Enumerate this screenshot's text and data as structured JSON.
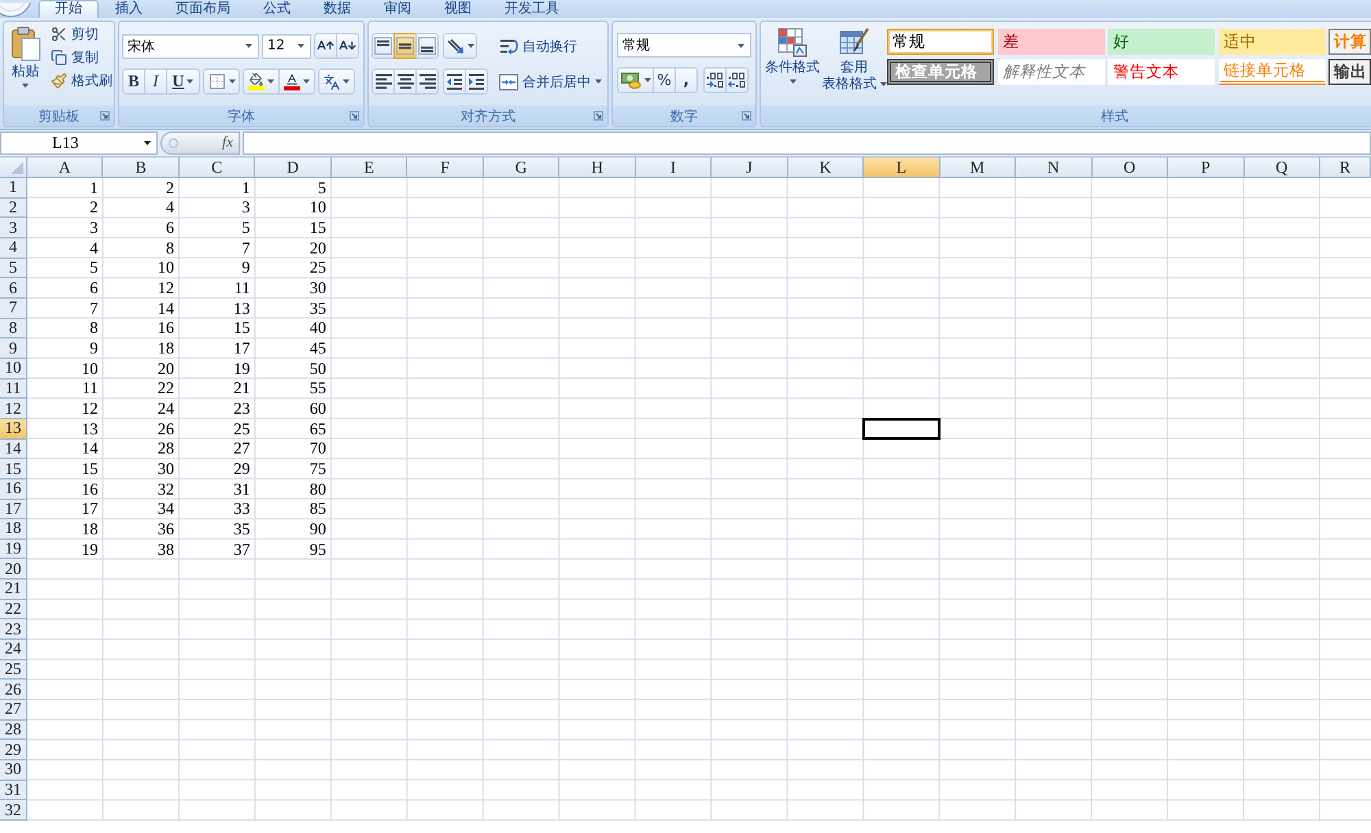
{
  "tabs": [
    {
      "label": "开始",
      "selected": true
    },
    {
      "label": "插入",
      "selected": false
    },
    {
      "label": "页面布局",
      "selected": false
    },
    {
      "label": "公式",
      "selected": false
    },
    {
      "label": "数据",
      "selected": false
    },
    {
      "label": "审阅",
      "selected": false
    },
    {
      "label": "视图",
      "selected": false
    },
    {
      "label": "开发工具",
      "selected": false
    }
  ],
  "clipboard": {
    "title": "剪贴板",
    "paste": "粘贴",
    "actions": [
      {
        "kind": "cut",
        "label": "剪切"
      },
      {
        "kind": "copy",
        "label": "复制"
      },
      {
        "kind": "format_painter",
        "label": "格式刷"
      }
    ]
  },
  "font": {
    "title": "字体",
    "font_name": "宋体",
    "font_size": "12",
    "styles": [
      {
        "kind": "bold",
        "label": "B"
      },
      {
        "kind": "italic",
        "label": "I"
      },
      {
        "kind": "underline",
        "label": "U"
      }
    ]
  },
  "alignment": {
    "title": "对齐方式",
    "vertical": [
      {
        "kind": "top",
        "selected": false
      },
      {
        "kind": "middle",
        "selected": true
      },
      {
        "kind": "bottom",
        "selected": false
      }
    ],
    "horizontal": [
      {
        "kind": "left",
        "selected": false
      },
      {
        "kind": "center",
        "selected": false
      },
      {
        "kind": "right",
        "selected": false
      }
    ],
    "wrap_text": "自动换行",
    "merge_center": "合并后居中"
  },
  "number": {
    "title": "数字",
    "format": "常规",
    "symbols": [
      {
        "kind": "percent",
        "label": "%"
      },
      {
        "kind": "comma",
        "label": ","
      }
    ]
  },
  "styles": {
    "title": "样式",
    "conditional_formatting": "条件格式",
    "format_as_table": [
      "套用",
      "表格格式"
    ],
    "cell_styles": [
      {
        "kind": "normal",
        "label": "常规",
        "selected": true
      },
      {
        "kind": "bad",
        "label": "差",
        "selected": false
      },
      {
        "kind": "good",
        "label": "好",
        "selected": false
      },
      {
        "kind": "neutral",
        "label": "适中",
        "selected": false
      },
      {
        "kind": "calculation",
        "label": "计算",
        "selected": false
      },
      {
        "kind": "check",
        "label": "检查单元格",
        "selected": false
      },
      {
        "kind": "explanatory",
        "label": "解释性文本",
        "selected": false
      },
      {
        "kind": "warning",
        "label": "警告文本",
        "selected": false
      },
      {
        "kind": "linked",
        "label": "链接单元格",
        "selected": false
      },
      {
        "kind": "output",
        "label": "输出",
        "selected": false
      }
    ]
  },
  "formula_bar": {
    "name_box": "L13",
    "function_label": "fx"
  },
  "grid": {
    "columns": [
      {
        "label": "A",
        "selected": false
      },
      {
        "label": "B",
        "selected": false
      },
      {
        "label": "C",
        "selected": false
      },
      {
        "label": "D",
        "selected": false
      },
      {
        "label": "E",
        "selected": false
      },
      {
        "label": "F",
        "selected": false
      },
      {
        "label": "G",
        "selected": false
      },
      {
        "label": "H",
        "selected": false
      },
      {
        "label": "I",
        "selected": false
      },
      {
        "label": "J",
        "selected": false
      },
      {
        "label": "K",
        "selected": false
      },
      {
        "label": "L",
        "selected": true
      },
      {
        "label": "M",
        "selected": false
      },
      {
        "label": "N",
        "selected": false
      },
      {
        "label": "O",
        "selected": false
      },
      {
        "label": "P",
        "selected": false
      },
      {
        "label": "Q",
        "selected": false
      },
      {
        "label": "R",
        "selected": false
      }
    ],
    "rows": [
      {
        "label": "1",
        "selected": false,
        "cells": [
          "1",
          "2",
          "1",
          "5"
        ]
      },
      {
        "label": "2",
        "selected": false,
        "cells": [
          "2",
          "4",
          "3",
          "10"
        ]
      },
      {
        "label": "3",
        "selected": false,
        "cells": [
          "3",
          "6",
          "5",
          "15"
        ]
      },
      {
        "label": "4",
        "selected": false,
        "cells": [
          "4",
          "8",
          "7",
          "20"
        ]
      },
      {
        "label": "5",
        "selected": false,
        "cells": [
          "5",
          "10",
          "9",
          "25"
        ]
      },
      {
        "label": "6",
        "selected": false,
        "cells": [
          "6",
          "12",
          "11",
          "30"
        ]
      },
      {
        "label": "7",
        "selected": false,
        "cells": [
          "7",
          "14",
          "13",
          "35"
        ]
      },
      {
        "label": "8",
        "selected": false,
        "cells": [
          "8",
          "16",
          "15",
          "40"
        ]
      },
      {
        "label": "9",
        "selected": false,
        "cells": [
          "9",
          "18",
          "17",
          "45"
        ]
      },
      {
        "label": "10",
        "selected": false,
        "cells": [
          "10",
          "20",
          "19",
          "50"
        ]
      },
      {
        "label": "11",
        "selected": false,
        "cells": [
          "11",
          "22",
          "21",
          "55"
        ]
      },
      {
        "label": "12",
        "selected": false,
        "cells": [
          "12",
          "24",
          "23",
          "60"
        ]
      },
      {
        "label": "13",
        "selected": true,
        "cells": [
          "13",
          "26",
          "25",
          "65"
        ]
      },
      {
        "label": "14",
        "selected": false,
        "cells": [
          "14",
          "28",
          "27",
          "70"
        ]
      },
      {
        "label": "15",
        "selected": false,
        "cells": [
          "15",
          "30",
          "29",
          "75"
        ]
      },
      {
        "label": "16",
        "selected": false,
        "cells": [
          "16",
          "32",
          "31",
          "80"
        ]
      },
      {
        "label": "17",
        "selected": false,
        "cells": [
          "17",
          "34",
          "33",
          "85"
        ]
      },
      {
        "label": "18",
        "selected": false,
        "cells": [
          "18",
          "36",
          "35",
          "90"
        ]
      },
      {
        "label": "19",
        "selected": false,
        "cells": [
          "19",
          "38",
          "37",
          "95"
        ]
      },
      {
        "label": "20",
        "selected": false
      },
      {
        "label": "21",
        "selected": false
      },
      {
        "label": "22",
        "selected": false
      },
      {
        "label": "23",
        "selected": false
      },
      {
        "label": "24",
        "selected": false
      },
      {
        "label": "25",
        "selected": false
      },
      {
        "label": "26",
        "selected": false
      },
      {
        "label": "27",
        "selected": false
      },
      {
        "label": "28",
        "selected": false
      },
      {
        "label": "29",
        "selected": false
      },
      {
        "label": "30",
        "selected": false
      },
      {
        "label": "31",
        "selected": false
      },
      {
        "label": "32",
        "selected": false
      }
    ]
  }
}
